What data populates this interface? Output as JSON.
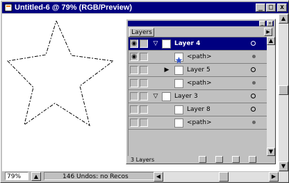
{
  "window": {
    "title": "Untitled-6 @ 79% (RGB/Preview)",
    "min_label": "_",
    "max_label": "□",
    "close_label": "x"
  },
  "status": {
    "zoom": "79%",
    "info": "146 Undos: no Recos"
  },
  "palette": {
    "tab": "Layers",
    "min_label": "_",
    "close_label": "x",
    "menu_label": "▶",
    "footer_count": "3 Layers",
    "layers": [
      {
        "name": "Layer 4",
        "selected": true
      },
      {
        "name": "<path>",
        "selected": false
      },
      {
        "name": "Layer 5",
        "selected": false
      },
      {
        "name": "<path>",
        "selected": false
      },
      {
        "name": "Layer 3",
        "selected": false
      },
      {
        "name": "Layer 8",
        "selected": false
      },
      {
        "name": "<path>",
        "selected": false
      }
    ]
  },
  "colors": {
    "title_bar": "#000080",
    "selection": "#000080",
    "chrome": "#c0c0c0",
    "canvas": "#ffffff"
  },
  "icons": {
    "app": "illustrator-doc-icon",
    "visibility": "eye-icon",
    "expand": "disclosure-triangle-icon"
  }
}
